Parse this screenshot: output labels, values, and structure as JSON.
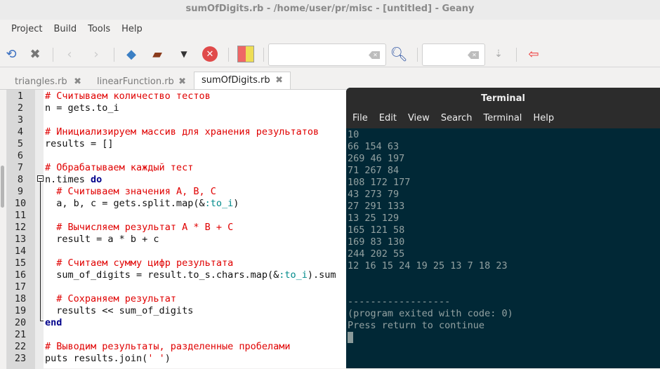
{
  "window": {
    "title": "sumOfDigits.rb - /home/user/pr/misc - [untitled] - Geany"
  },
  "menu": [
    "Project",
    "Build",
    "Tools",
    "Help"
  ],
  "toolbar": {
    "search_placeholder": "",
    "goto_placeholder": ""
  },
  "tabs": [
    {
      "label": "triangles.rb"
    },
    {
      "label": "linearFunction.rb"
    },
    {
      "label": "sumOfDigits.rb",
      "active": true
    }
  ],
  "code": [
    [
      [
        "cm",
        "# Считываем количество тестов"
      ]
    ],
    [
      [
        "",
        "n = gets.to_i"
      ]
    ],
    [],
    [
      [
        "cm",
        "# Инициализируем массив для хранения результатов"
      ]
    ],
    [
      [
        "",
        "results = []"
      ]
    ],
    [],
    [
      [
        "cm",
        "# Обрабатываем каждый тест"
      ]
    ],
    [
      [
        "",
        "n.times "
      ],
      [
        "kw",
        "do"
      ]
    ],
    [
      [
        "",
        "  "
      ],
      [
        "cm",
        "# Считываем значения A, B, C"
      ]
    ],
    [
      [
        "",
        "  a, b, c = gets.split.map(&"
      ],
      [
        "sym",
        ":to_i"
      ],
      [
        "",
        ")"
      ]
    ],
    [],
    [
      [
        "",
        "  "
      ],
      [
        "cm",
        "# Вычисляем результат A * B + C"
      ]
    ],
    [
      [
        "",
        "  result = a * b + c"
      ]
    ],
    [],
    [
      [
        "",
        "  "
      ],
      [
        "cm",
        "# Считаем сумму цифр результата"
      ]
    ],
    [
      [
        "",
        "  sum_of_digits = result.to_s.chars.map(&"
      ],
      [
        "sym",
        ":to_i"
      ],
      [
        "",
        ").sum"
      ]
    ],
    [],
    [
      [
        "",
        "  "
      ],
      [
        "cm",
        "# Сохраняем результат"
      ]
    ],
    [
      [
        "",
        "  results << sum_of_digits"
      ]
    ],
    [
      [
        "kw",
        "end"
      ]
    ],
    [],
    [
      [
        "cm",
        "# Выводим результаты, разделенные пробелами"
      ]
    ],
    [
      [
        "",
        "puts results.join("
      ],
      [
        "st",
        "' '"
      ],
      [
        "",
        ")"
      ]
    ]
  ],
  "terminal": {
    "title": "Terminal",
    "menu": [
      "File",
      "Edit",
      "View",
      "Search",
      "Terminal",
      "Help"
    ],
    "lines": [
      "10",
      "66 154 63",
      "269 46 197",
      "71 267 84",
      "108 172 177",
      "43 273 79",
      "27 291 133",
      "13 25 129",
      "165 121 58",
      "169 83 130",
      "244 202 55",
      "12 16 15 24 19 25 13 7 18 23",
      "",
      "",
      "------------------",
      "(program exited with code: 0)",
      "Press return to continue"
    ]
  }
}
